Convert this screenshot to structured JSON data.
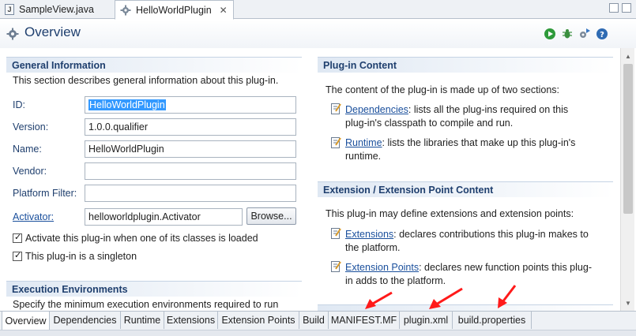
{
  "editor_tabs": [
    {
      "label": "SampleView.java",
      "active": false
    },
    {
      "label": "HelloWorldPlugin",
      "active": true
    }
  ],
  "header": {
    "title": "Overview"
  },
  "general": {
    "title": "General Information",
    "description": "This section describes general information about this plug-in.",
    "id_label": "ID:",
    "id_value": "HelloWorldPlugin",
    "version_label": "Version:",
    "version_value": "1.0.0.qualifier",
    "name_label": "Name:",
    "name_value": "HelloWorldPlugin",
    "vendor_label": "Vendor:",
    "vendor_value": "",
    "platform_label": "Platform Filter:",
    "platform_value": "",
    "activator_label": "Activator:",
    "activator_value": "helloworldplugin.Activator",
    "browse_label": "Browse...",
    "activate_check": "Activate this plug-in when one of its classes is loaded",
    "singleton_check": "This plug-in is a singleton"
  },
  "exec": {
    "title": "Execution Environments",
    "description": "Specify the minimum execution environments required to run"
  },
  "plugin_content": {
    "title": "Plug-in Content",
    "description": "The content of the plug-in is made up of two sections:",
    "dep_link": "Dependencies",
    "dep_text_1": ": lists all the plug-ins required on this",
    "dep_text_2": "plug-in's classpath to compile and run.",
    "rt_link": "Runtime",
    "rt_text_1": ": lists the libraries that make up this plug-in's",
    "rt_text_2": "runtime."
  },
  "ext_content": {
    "title": "Extension / Extension Point Content",
    "description": "This plug-in may define extensions and extension points:",
    "ext_link": "Extensions",
    "ext_text_1": ": declares contributions this plug-in makes to",
    "ext_text_2": "the platform.",
    "ep_link": "Extension Points",
    "ep_text_1": ": declares new function points this plug-",
    "ep_text_2": "in adds to the platform."
  },
  "page_tabs": [
    "Overview",
    "Dependencies",
    "Runtime",
    "Extensions",
    "Extension Points",
    "Build",
    "MANIFEST.MF",
    "plugin.xml",
    "build.properties"
  ],
  "colors": {
    "accent": "#1f3f6e",
    "link": "#1a4f9c",
    "selection": "#3399ff",
    "annotation_arrow": "#ff1a1a"
  }
}
